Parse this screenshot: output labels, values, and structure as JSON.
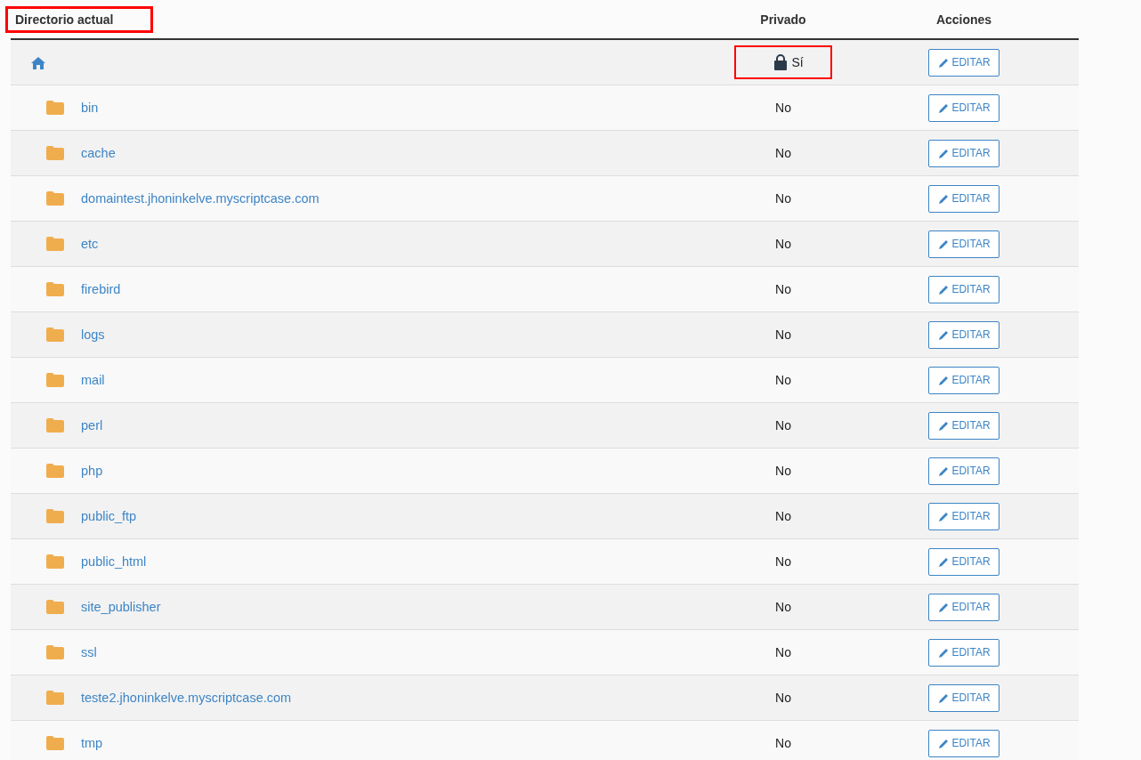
{
  "table": {
    "columns": [
      {
        "label": "Directorio actual",
        "highlighted": true
      },
      {
        "label": "Privado",
        "highlighted": false
      },
      {
        "label": "Acciones",
        "highlighted": false
      }
    ],
    "rows": [
      {
        "kind": "home",
        "private": true,
        "privacy": "Sí",
        "highlighted": true,
        "action": "EDITAR"
      },
      {
        "kind": "folder",
        "name": "bin",
        "private": false,
        "privacy": "No",
        "highlighted": false,
        "action": "EDITAR"
      },
      {
        "kind": "folder",
        "name": "cache",
        "private": false,
        "privacy": "No",
        "highlighted": false,
        "action": "EDITAR"
      },
      {
        "kind": "folder",
        "name": "domaintest.jhoninkelve.myscriptcase.com",
        "private": false,
        "privacy": "No",
        "highlighted": false,
        "action": "EDITAR"
      },
      {
        "kind": "folder",
        "name": "etc",
        "private": false,
        "privacy": "No",
        "highlighted": false,
        "action": "EDITAR"
      },
      {
        "kind": "folder",
        "name": "firebird",
        "private": false,
        "privacy": "No",
        "highlighted": false,
        "action": "EDITAR"
      },
      {
        "kind": "folder",
        "name": "logs",
        "private": false,
        "privacy": "No",
        "highlighted": false,
        "action": "EDITAR"
      },
      {
        "kind": "folder",
        "name": "mail",
        "private": false,
        "privacy": "No",
        "highlighted": false,
        "action": "EDITAR"
      },
      {
        "kind": "folder",
        "name": "perl",
        "private": false,
        "privacy": "No",
        "highlighted": false,
        "action": "EDITAR"
      },
      {
        "kind": "folder",
        "name": "php",
        "private": false,
        "privacy": "No",
        "highlighted": false,
        "action": "EDITAR"
      },
      {
        "kind": "folder",
        "name": "public_ftp",
        "private": false,
        "privacy": "No",
        "highlighted": false,
        "action": "EDITAR"
      },
      {
        "kind": "folder",
        "name": "public_html",
        "private": false,
        "privacy": "No",
        "highlighted": false,
        "action": "EDITAR"
      },
      {
        "kind": "folder",
        "name": "site_publisher",
        "private": false,
        "privacy": "No",
        "highlighted": false,
        "action": "EDITAR"
      },
      {
        "kind": "folder",
        "name": "ssl",
        "private": false,
        "privacy": "No",
        "highlighted": false,
        "action": "EDITAR"
      },
      {
        "kind": "folder",
        "name": "teste2.jhoninkelve.myscriptcase.com",
        "private": false,
        "privacy": "No",
        "highlighted": false,
        "action": "EDITAR"
      },
      {
        "kind": "folder",
        "name": "tmp",
        "private": false,
        "privacy": "No",
        "highlighted": false,
        "action": "EDITAR"
      }
    ]
  }
}
